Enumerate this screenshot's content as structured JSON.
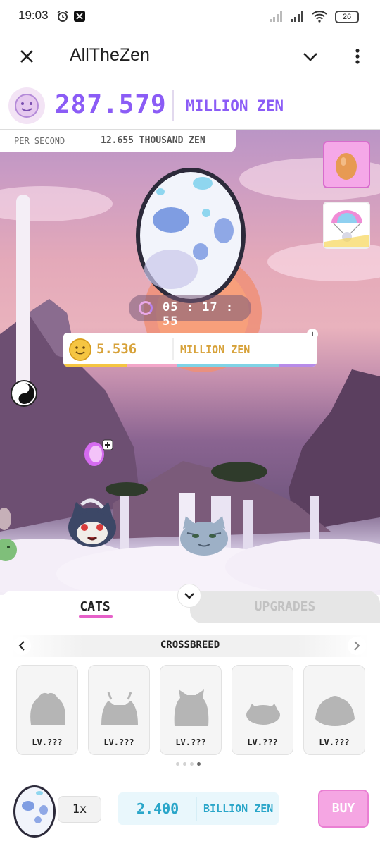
{
  "status_bar": {
    "time": "19:03",
    "battery": "26",
    "icons": [
      "alarm-icon",
      "x-app-icon",
      "signal-icon",
      "signal-icon",
      "wifi-icon",
      "battery-icon"
    ]
  },
  "app_bar": {
    "title": "AllTheZen",
    "close_icon": "close-icon",
    "chevron_icon": "chevron-down-icon",
    "menu_icon": "more-vert-icon"
  },
  "zen": {
    "amount": "287.579",
    "unit": "MILLION ZEN",
    "per_second_label": "PER SECOND",
    "per_second_value": "12.655 THOUSAND ZEN"
  },
  "egg": {
    "timer": "05 : 17 : 55"
  },
  "offer": {
    "amount": "5.536",
    "unit": "MILLION ZEN",
    "info_glyph": "i"
  },
  "tabs": {
    "cats": "CATS",
    "upgrades": "UPGRADES"
  },
  "category": {
    "label": "CROSSBREED"
  },
  "cats": [
    {
      "level": "LV.???"
    },
    {
      "level": "LV.???"
    },
    {
      "level": "LV.???"
    },
    {
      "level": "LV.???"
    },
    {
      "level": "LV.???"
    }
  ],
  "pagination": {
    "pages": 4,
    "active": 3
  },
  "buy": {
    "quantity": "1x",
    "price": "2.400",
    "unit": "BILLION ZEN",
    "button": "BUY"
  },
  "colors": {
    "zen_purple": "#8b5cf6",
    "offer_gold": "#d7a23a",
    "price_blue": "#2aa6c9",
    "buy_pink": "#f5a6e3",
    "tab_underline": "#e660c9"
  }
}
